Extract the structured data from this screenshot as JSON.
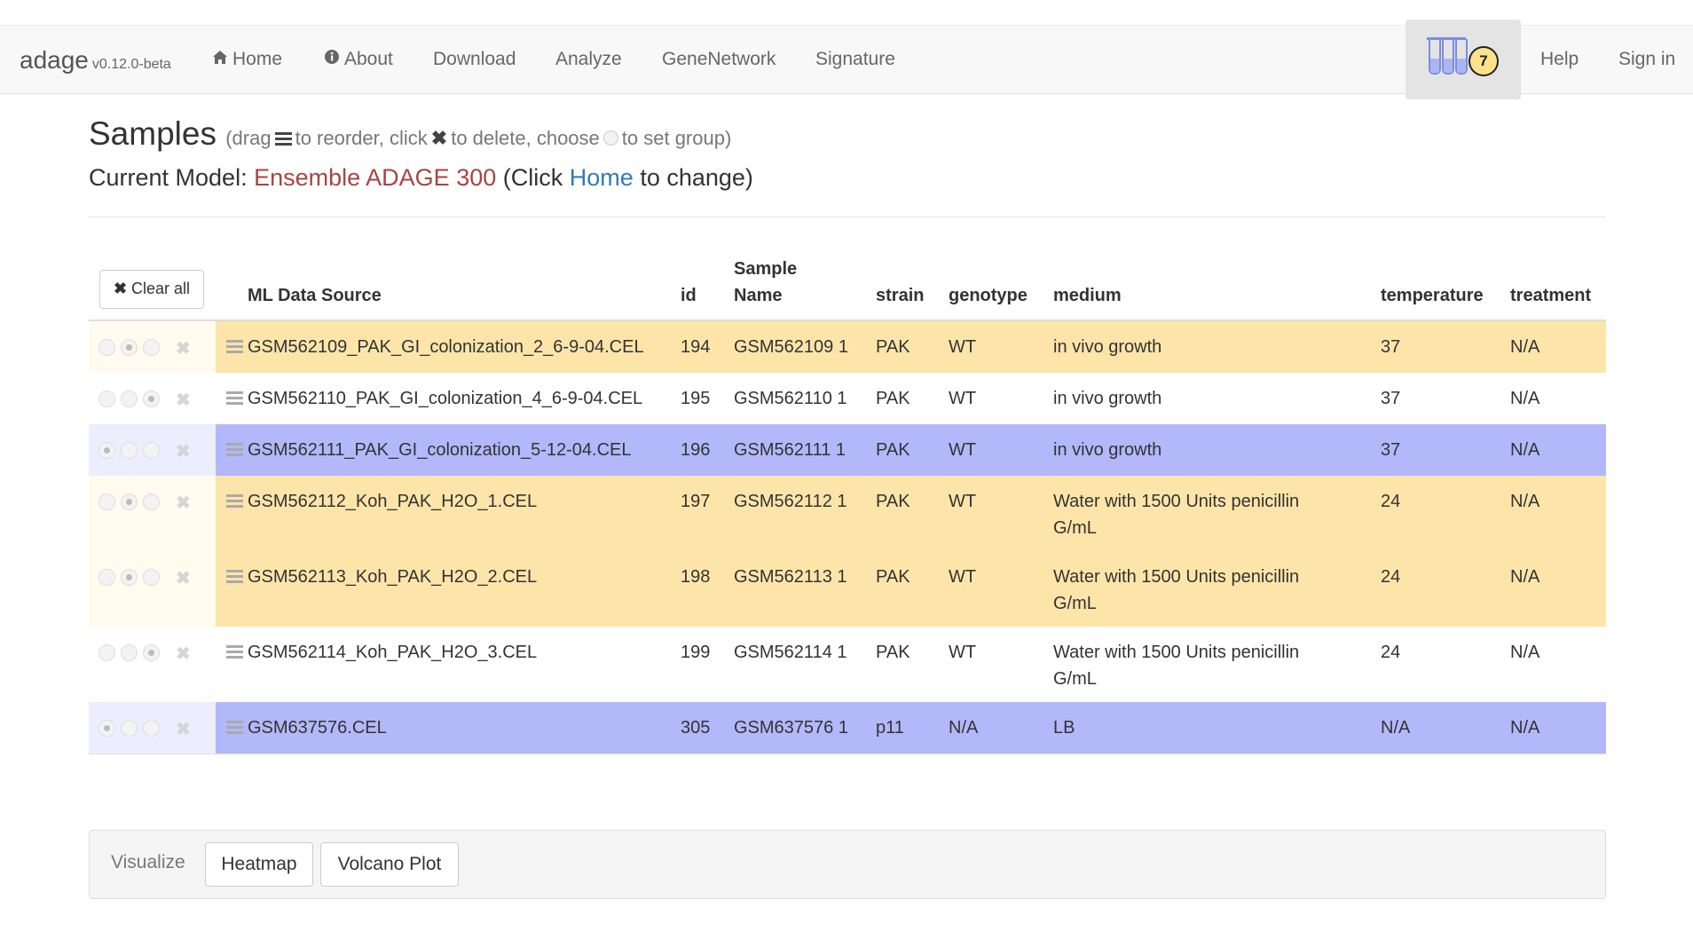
{
  "navbar": {
    "brand": "adage",
    "version": "v0.12.0-beta",
    "items": [
      {
        "label": "Home",
        "icon": "home-icon"
      },
      {
        "label": "About",
        "icon": "info-circle-icon"
      },
      {
        "label": "Download"
      },
      {
        "label": "Analyze"
      },
      {
        "label": "GeneNetwork"
      },
      {
        "label": "Signature"
      }
    ],
    "basket_count": "7",
    "help": "Help",
    "sign_in": "Sign in"
  },
  "header": {
    "title": "Samples",
    "hint_prefix": "(drag",
    "hint_reorder": "to reorder, click",
    "hint_delete": "to delete, choose",
    "hint_group": "to set group)",
    "model_prefix": "Current Model:",
    "model_name": "Ensemble ADAGE 300",
    "model_click": "(Click",
    "model_home": "Home",
    "model_suffix": "to change)"
  },
  "table": {
    "clear_all": "Clear all",
    "columns": [
      "ML Data Source",
      "id",
      "Sample Name",
      "strain",
      "genotype",
      "medium",
      "temperature",
      "treatment"
    ],
    "colors": {
      "group_a": "#fde5a9",
      "group_b": "#b3b8fa",
      "none": "#ffffff"
    },
    "rows": [
      {
        "source": "GSM562109_PAK_GI_colonization_2_6-9-04.CEL",
        "id": "194",
        "sample": "GSM562109 1",
        "strain": "PAK",
        "genotype": "WT",
        "medium": "in vivo growth",
        "temperature": "37",
        "treatment": "N/A",
        "group": "a"
      },
      {
        "source": "GSM562110_PAK_GI_colonization_4_6-9-04.CEL",
        "id": "195",
        "sample": "GSM562110 1",
        "strain": "PAK",
        "genotype": "WT",
        "medium": "in vivo growth",
        "temperature": "37",
        "treatment": "N/A",
        "group": "none"
      },
      {
        "source": "GSM562111_PAK_GI_colonization_5-12-04.CEL",
        "id": "196",
        "sample": "GSM562111 1",
        "strain": "PAK",
        "genotype": "WT",
        "medium": "in vivo growth",
        "temperature": "37",
        "treatment": "N/A",
        "group": "b"
      },
      {
        "source": "GSM562112_Koh_PAK_H2O_1.CEL",
        "id": "197",
        "sample": "GSM562112 1",
        "strain": "PAK",
        "genotype": "WT",
        "medium": "Water with 1500 Units penicillin G/mL",
        "temperature": "24",
        "treatment": "N/A",
        "group": "a"
      },
      {
        "source": "GSM562113_Koh_PAK_H2O_2.CEL",
        "id": "198",
        "sample": "GSM562113 1",
        "strain": "PAK",
        "genotype": "WT",
        "medium": "Water with 1500 Units penicillin G/mL",
        "temperature": "24",
        "treatment": "N/A",
        "group": "a"
      },
      {
        "source": "GSM562114_Koh_PAK_H2O_3.CEL",
        "id": "199",
        "sample": "GSM562114 1",
        "strain": "PAK",
        "genotype": "WT",
        "medium": "Water with 1500 Units penicillin G/mL",
        "temperature": "24",
        "treatment": "N/A",
        "group": "none"
      },
      {
        "source": "GSM637576.CEL",
        "id": "305",
        "sample": "GSM637576 1",
        "strain": "p11",
        "genotype": "N/A",
        "medium": "LB",
        "temperature": "N/A",
        "treatment": "N/A",
        "group": "b"
      }
    ]
  },
  "visualize": {
    "label": "Visualize",
    "heatmap": "Heatmap",
    "volcano": "Volcano Plot"
  }
}
